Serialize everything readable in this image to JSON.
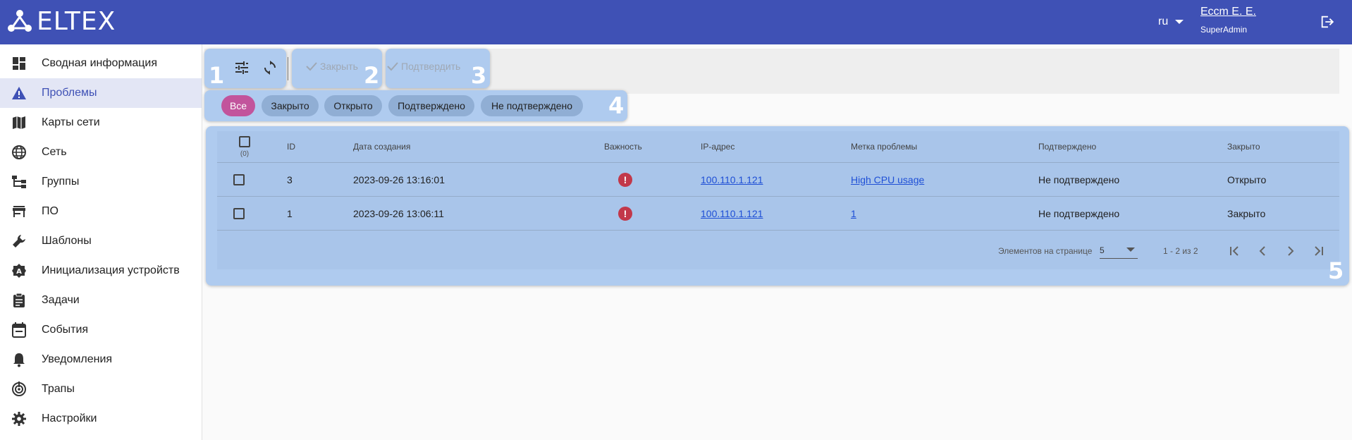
{
  "header": {
    "logo_text": "ELTEX",
    "lang": "ru",
    "user_name": "Ессm Е. Е.",
    "user_role": "SuperAdmin"
  },
  "sidebar": {
    "items": [
      {
        "label": "Сводная информация",
        "icon": "dashboard-icon"
      },
      {
        "label": "Проблемы",
        "icon": "warning-icon",
        "active": true
      },
      {
        "label": "Карты сети",
        "icon": "map-icon"
      },
      {
        "label": "Сеть",
        "icon": "globe-icon"
      },
      {
        "label": "Группы",
        "icon": "tree-icon"
      },
      {
        "label": "ПО",
        "icon": "store-icon"
      },
      {
        "label": "Шаблоны",
        "icon": "wrench-icon"
      },
      {
        "label": "Инициализация устройств",
        "icon": "auto-badge-icon"
      },
      {
        "label": "Задачи",
        "icon": "clipboard-icon"
      },
      {
        "label": "События",
        "icon": "calendar-icon"
      },
      {
        "label": "Уведомления",
        "icon": "bell-icon"
      },
      {
        "label": "Трапы",
        "icon": "target-icon"
      },
      {
        "label": "Настройки",
        "icon": "gear-icon"
      }
    ]
  },
  "toolbar": {
    "close_label": "Закрыть",
    "confirm_label": "Подтвердить",
    "callouts": [
      "1",
      "2",
      "3",
      "4",
      "5"
    ]
  },
  "filters": [
    "Все",
    "Закрыто",
    "Открыто",
    "Подтверждено",
    "Не подтверждено"
  ],
  "table": {
    "columns": [
      "ID",
      "Дата создания",
      "Важность",
      "IP-адрес",
      "Метка проблемы",
      "Подтверждено",
      "Закрыто"
    ],
    "selected_count": "(0)",
    "rows": [
      {
        "id": "3",
        "date": "2023-09-26 13:16:01",
        "severity": "!",
        "ip": "100.110.1.121",
        "label": "High CPU usage",
        "confirmed": "Не подтверждено",
        "closed": "Открыто"
      },
      {
        "id": "1",
        "date": "2023-09-26 13:06:11",
        "severity": "!",
        "ip": "100.110.1.121",
        "label": "1",
        "confirmed": "Не подтверждено",
        "closed": "Закрыто"
      }
    ]
  },
  "pagination": {
    "per_page_label": "Элементов на странице",
    "per_page_value": "5",
    "range": "1 - 2 из 2"
  },
  "colors": {
    "header": "#3f51b5",
    "highlight": "#afcbef",
    "active_chip": "#c2549c",
    "severity": "#c2384a",
    "link": "#1e4fd6"
  }
}
